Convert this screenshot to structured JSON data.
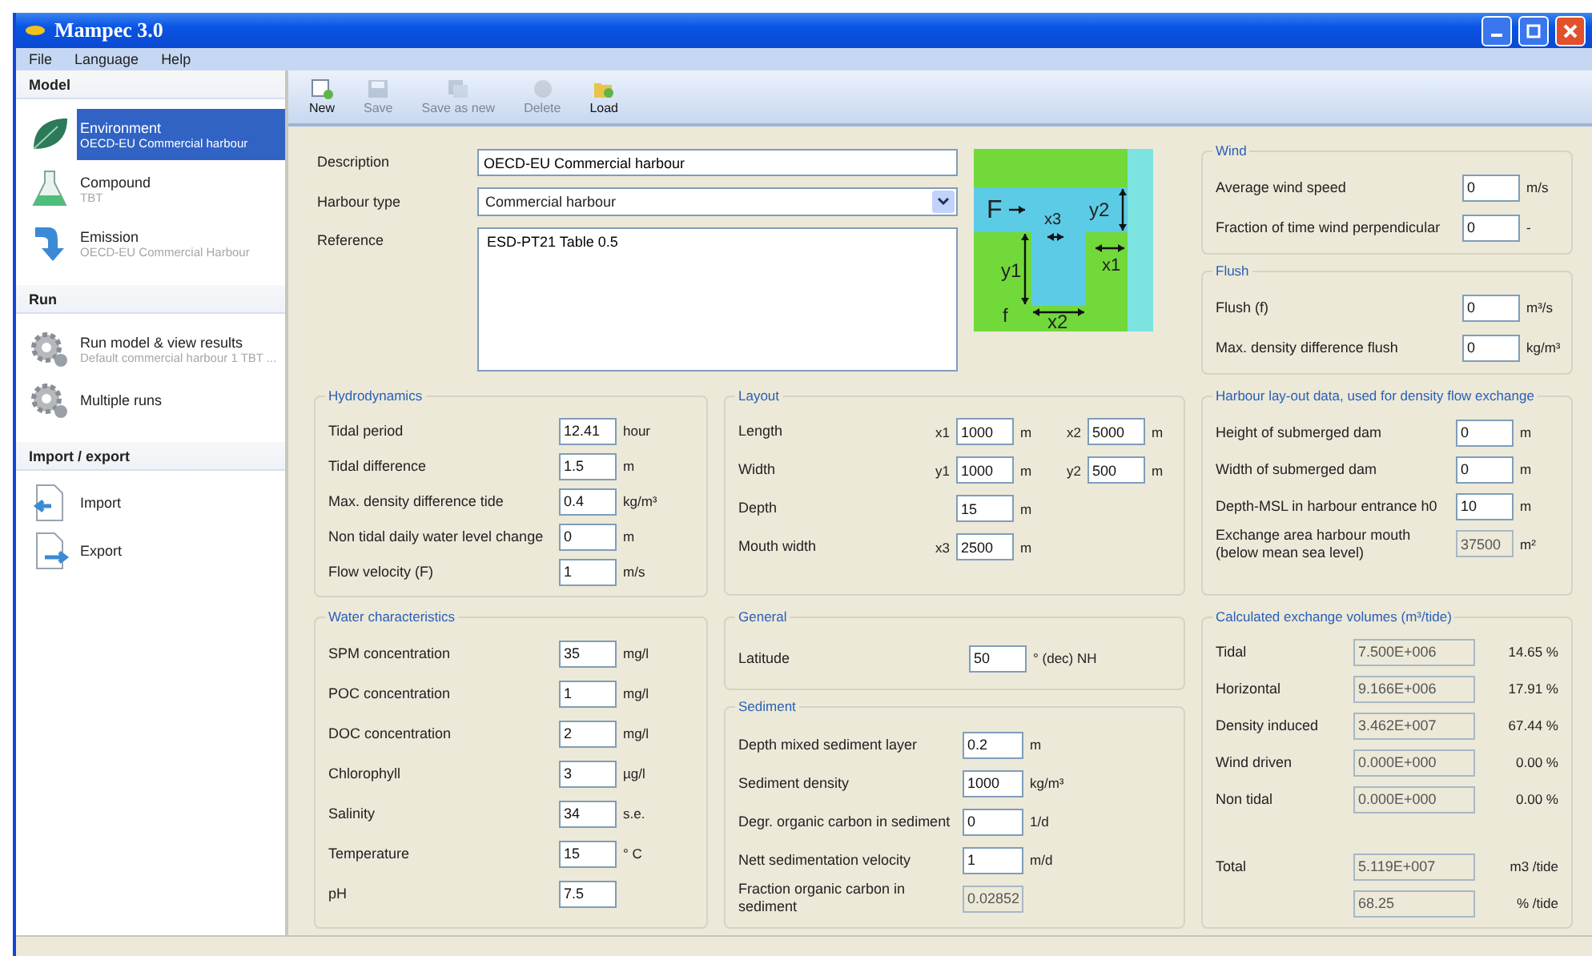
{
  "window": {
    "title": "Mampec 3.0"
  },
  "menu": [
    "File",
    "Language",
    "Help"
  ],
  "sidebar": {
    "sections": [
      {
        "title": "Model",
        "items": [
          {
            "kind": "leaf",
            "title": "Environment",
            "subtitle": "OECD-EU Commercial harbour",
            "selected": true
          },
          {
            "kind": "flask",
            "title": "Compound",
            "subtitle": "TBT",
            "selected": false
          },
          {
            "kind": "arrow",
            "title": "Emission",
            "subtitle": "OECD-EU Commercial Harbour",
            "selected": false
          }
        ]
      },
      {
        "title": "Run",
        "items": [
          {
            "kind": "gears",
            "title": "Run model & view results",
            "subtitle": "Default commercial harbour 1 TBT ...",
            "selected": false
          },
          {
            "kind": "gears",
            "title": "Multiple runs",
            "selected": false
          }
        ]
      },
      {
        "title": "Import / export",
        "items": [
          {
            "kind": "import",
            "title": "Import",
            "selected": false
          },
          {
            "kind": "export",
            "title": "Export",
            "selected": false
          }
        ]
      }
    ]
  },
  "toolbar": [
    {
      "kind": "new",
      "label": "New",
      "disabled": false
    },
    {
      "kind": "save",
      "label": "Save",
      "disabled": true
    },
    {
      "kind": "saveas",
      "label": "Save as new",
      "disabled": true
    },
    {
      "kind": "delete",
      "label": "Delete",
      "disabled": true
    },
    {
      "kind": "load",
      "label": "Load",
      "disabled": false
    }
  ],
  "form": {
    "description": {
      "label": "Description",
      "value": "OECD-EU Commercial harbour"
    },
    "harbour_type": {
      "label": "Harbour type",
      "value": "Commercial harbour"
    },
    "reference": {
      "label": "Reference",
      "value": "ESD-PT21 Table 0.5"
    }
  },
  "diagram": {
    "labels": [
      "F",
      "x3",
      "y2",
      "x1",
      "y1",
      "f",
      "x2"
    ]
  },
  "hydrodynamics": {
    "title": "Hydrodynamics",
    "fields": [
      {
        "label": "Tidal period",
        "value": "12.41",
        "unit": "hour"
      },
      {
        "label": "Tidal difference",
        "value": "1.5",
        "unit": "m"
      },
      {
        "label": "Max. density difference tide",
        "value": "0.4",
        "unit": "kg/m³"
      },
      {
        "label": "Non tidal daily water level change",
        "value": "0",
        "unit": "m"
      },
      {
        "label": "Flow velocity (F)",
        "value": "1",
        "unit": "m/s"
      }
    ]
  },
  "water": {
    "title": "Water characteristics",
    "fields": [
      {
        "label": "SPM concentration",
        "value": "35",
        "unit": "mg/l"
      },
      {
        "label": "POC concentration",
        "value": "1",
        "unit": "mg/l"
      },
      {
        "label": "DOC concentration",
        "value": "2",
        "unit": "mg/l"
      },
      {
        "label": "Chlorophyll",
        "value": "3",
        "unit": "µg/l"
      },
      {
        "label": "Salinity",
        "value": "34",
        "unit": "s.e."
      },
      {
        "label": "Temperature",
        "value": "15",
        "unit": "° C"
      },
      {
        "label": "pH",
        "value": "7.5"
      }
    ]
  },
  "layout": {
    "title": "Layout",
    "rows": [
      {
        "label": "Length",
        "fields": [
          {
            "prefix": "x1",
            "value": "1000",
            "unit": "m"
          },
          {
            "prefix": "x2",
            "value": "5000",
            "unit": "m"
          }
        ]
      },
      {
        "label": "Width",
        "fields": [
          {
            "prefix": "y1",
            "value": "1000",
            "unit": "m"
          },
          {
            "prefix": "y2",
            "value": "500",
            "unit": "m"
          }
        ]
      },
      {
        "label": "Depth",
        "fields": [
          {
            "value": "15",
            "unit": "m"
          }
        ]
      },
      {
        "label": "Mouth width",
        "fields": [
          {
            "prefix": "x3",
            "value": "2500",
            "unit": "m"
          }
        ]
      }
    ]
  },
  "general": {
    "title": "General",
    "fields": [
      {
        "label": "Latitude",
        "value": "50",
        "unit": "° (dec) NH"
      }
    ]
  },
  "sediment": {
    "title": "Sediment",
    "fields": [
      {
        "label": "Depth mixed sediment layer",
        "value": "0.2",
        "unit": "m",
        "readonly": false
      },
      {
        "label": "Sediment density",
        "value": "1000",
        "unit": "kg/m³",
        "readonly": false
      },
      {
        "label": "Degr. organic carbon in sediment",
        "value": "0",
        "unit": "1/d",
        "readonly": false
      },
      {
        "label": "Nett sedimentation velocity",
        "value": "1",
        "unit": "m/d",
        "readonly": false
      },
      {
        "label": "Fraction organic carbon in sediment",
        "value": "0.02852",
        "readonly": true
      }
    ]
  },
  "wind": {
    "title": "Wind",
    "fields": [
      {
        "label": "Average wind speed",
        "value": "0",
        "unit": "m/s"
      },
      {
        "label": "Fraction of time wind perpendicular",
        "value": "0",
        "unit": "-"
      }
    ]
  },
  "flush": {
    "title": "Flush",
    "fields": [
      {
        "label": "Flush (f)",
        "value": "0",
        "unit": "m³/s"
      },
      {
        "label": "Max. density difference flush",
        "value": "0",
        "unit": "kg/m³"
      }
    ]
  },
  "harbour_layout": {
    "title": "Harbour lay-out data, used for density flow exchange",
    "fields": [
      {
        "label": "Height of submerged dam",
        "value": "0",
        "unit": "m",
        "readonly": false
      },
      {
        "label": "Width of submerged dam",
        "value": "0",
        "unit": "m",
        "readonly": false
      },
      {
        "label": "Depth-MSL in harbour entrance  h0",
        "value": "10",
        "unit": "m",
        "readonly": false
      },
      {
        "label": "Exchange area harbour mouth (below mean sea level)",
        "value": "37500",
        "unit": "m²",
        "readonly": true
      }
    ]
  },
  "exchange": {
    "title": "Calculated exchange volumes (m³/tide)",
    "rows": [
      {
        "label": "Tidal",
        "value": "7.500E+006",
        "share": "14.65 %"
      },
      {
        "label": "Horizontal",
        "value": "9.166E+006",
        "share": "17.91 %"
      },
      {
        "label": "Density induced",
        "value": "3.462E+007",
        "share": "67.44 %"
      },
      {
        "label": "Wind driven",
        "value": "0.000E+000",
        "share": "0.00 %"
      },
      {
        "label": "Non tidal",
        "value": "0.000E+000",
        "share": "0.00 %"
      }
    ],
    "totals": [
      {
        "label": "Total",
        "value": "5.119E+007",
        "unit": "m3 /tide"
      },
      {
        "value": "68.25",
        "unit": "% /tide"
      }
    ]
  }
}
